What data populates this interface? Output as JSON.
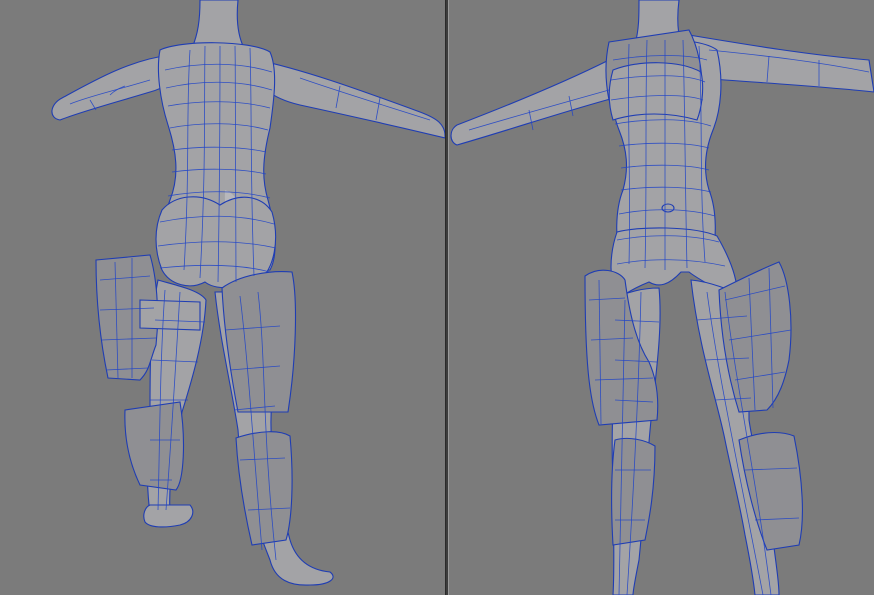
{
  "layout": "split-viewport",
  "viewports": [
    {
      "view": "back",
      "model": "female-character-wireframe"
    },
    {
      "view": "front",
      "model": "female-character-wireframe"
    }
  ],
  "colors": {
    "background": "#7b7b7b",
    "mesh_surface": "#a3a3a6",
    "wireframe": "#1f3db3",
    "divider": "#3c3c3c"
  }
}
